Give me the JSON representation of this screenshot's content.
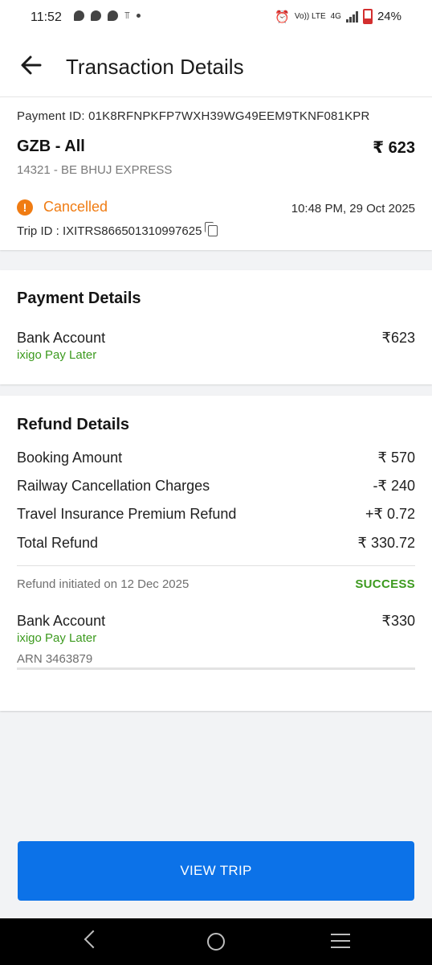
{
  "status_bar": {
    "time": "11:52",
    "network_label": "Vo)) LTE",
    "network_type": "4G",
    "battery": "24%"
  },
  "header": {
    "title": "Transaction Details"
  },
  "summary": {
    "payment_id": "Payment ID:  01K8RFNPKFP7WXH39WG49EEM9TKNF081KPR",
    "route": "GZB - All",
    "fare": "₹ 623",
    "train": "14321 - BE BHUJ EXPRESS",
    "status": "Cancelled",
    "status_symbol": "!",
    "datetime": "10:48 PM, 29 Oct 2025",
    "trip_id": "Trip ID :  IXITRS866501310997625"
  },
  "payment_details": {
    "title": "Payment Details",
    "method": "Bank Account",
    "amount": "₹623",
    "provider": "ixigo Pay Later"
  },
  "refund_details": {
    "title": "Refund Details",
    "rows": [
      {
        "label": "Booking Amount",
        "value": "₹ 570"
      },
      {
        "label": "Railway Cancellation Charges",
        "value": "-₹ 240"
      },
      {
        "label": "Travel Insurance Premium Refund",
        "value": "+₹ 0.72"
      },
      {
        "label": "Total Refund",
        "value": "₹ 330.72"
      }
    ],
    "initiated": "Refund initiated on 12 Dec 2025",
    "status": "SUCCESS",
    "method": "Bank Account",
    "amount": "₹330",
    "provider": "ixigo Pay Later",
    "arn": "ARN 3463879"
  },
  "actions": {
    "view_trip": "VIEW TRIP"
  },
  "colors": {
    "accent": "#0c72e8",
    "cancelled": "#f07c13",
    "success": "#3c9a1e"
  }
}
